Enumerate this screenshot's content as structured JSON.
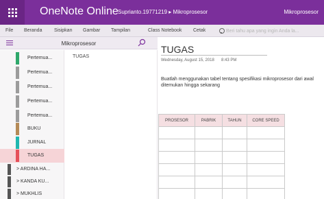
{
  "titlebar": {
    "app_name": "OneNote Online",
    "breadcrumb": "Suprianto.19771219 ▸ Mikroprosesor",
    "notebook_title": "Mikroprosesor"
  },
  "ribbon": {
    "tabs": [
      "File",
      "Beranda",
      "Sisipkan",
      "Gambar",
      "Tampilan",
      "Class Notebook",
      "Cetak"
    ],
    "tell_me": "Beri tahu apa yang ingin Anda la..."
  },
  "nav": {
    "header_title": "Mikroprosesor"
  },
  "sections": [
    {
      "label": "Pertemua...",
      "color": "#2fa86b"
    },
    {
      "label": "Pertemua...",
      "color": "#9c9c9c"
    },
    {
      "label": "Pertemua...",
      "color": "#9c9c9c"
    },
    {
      "label": "Pertemua...",
      "color": "#9c9c9c"
    },
    {
      "label": "Pertemua...",
      "color": "#9c9c9c"
    },
    {
      "label": "BUKU",
      "color": "#b58a57"
    },
    {
      "label": "JURNAL",
      "color": "#1fb7b0"
    },
    {
      "label": "TUGAS",
      "color": "#e6505a"
    }
  ],
  "section_groups": [
    {
      "label": "ARDINA HA..."
    },
    {
      "label": "KANDA KU..."
    },
    {
      "label": "MUKHLIS"
    }
  ],
  "pages": [
    {
      "label": "TUGAS"
    }
  ],
  "page": {
    "title": "TUGAS",
    "date": "Wednesday, August 15, 2018",
    "time": "8:43 PM",
    "body": "Buatlah menggunakan tabel tentang spesifikasi mikroprosesor dari awal ditemukan hingga sekarang",
    "table": {
      "headers": [
        "PROSESOR",
        "PABRIK",
        "TAHUN",
        "CORE SPEED"
      ],
      "rows": [
        [
          "",
          "",
          "",
          ""
        ],
        [
          "",
          "",
          "",
          ""
        ],
        [
          "",
          "",
          "",
          ""
        ],
        [
          "",
          "",
          "",
          ""
        ],
        [
          "",
          "",
          "",
          ""
        ],
        [
          "",
          "",
          "",
          ""
        ]
      ]
    }
  },
  "colors": {
    "brand": "#7b2f9b",
    "active_section": "#f6d4d7",
    "table_header": "#f5dfe2"
  }
}
